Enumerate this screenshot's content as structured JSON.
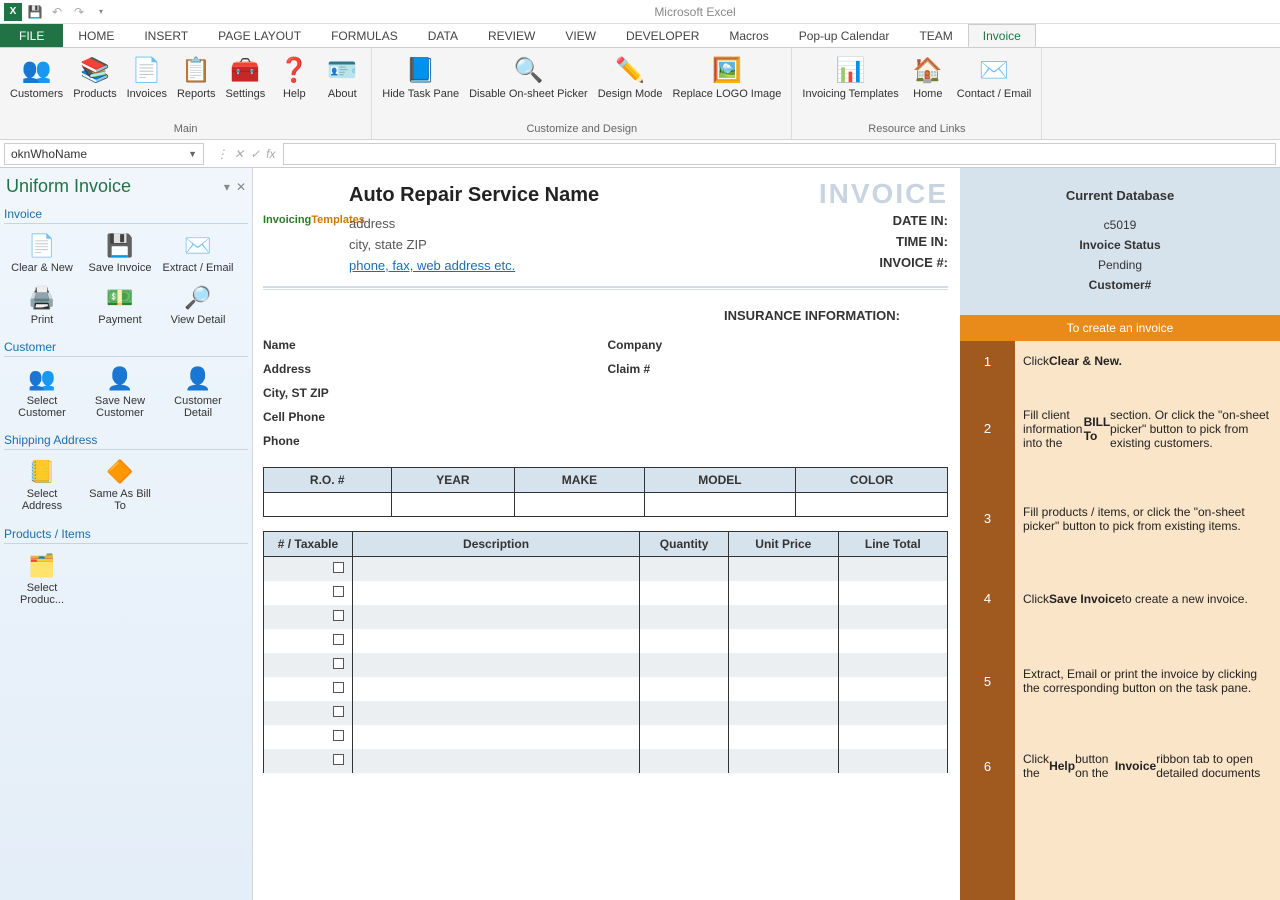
{
  "titlebar": {
    "app_title": "Microsoft Excel"
  },
  "ribbon": {
    "tabs": [
      "FILE",
      "HOME",
      "INSERT",
      "PAGE LAYOUT",
      "FORMULAS",
      "DATA",
      "REVIEW",
      "VIEW",
      "DEVELOPER",
      "Macros",
      "Pop-up Calendar",
      "TEAM",
      "Invoice"
    ],
    "active_tab": "Invoice",
    "groups": [
      {
        "label": "Main",
        "items": [
          {
            "label": "Customers",
            "icon": "👥"
          },
          {
            "label": "Products",
            "icon": "📚"
          },
          {
            "label": "Invoices",
            "icon": "📄"
          },
          {
            "label": "Reports",
            "icon": "📋"
          },
          {
            "label": "Settings",
            "icon": "🧰"
          },
          {
            "label": "Help",
            "icon": "❓"
          },
          {
            "label": "About",
            "icon": "🪪"
          }
        ]
      },
      {
        "label": "Customize and Design",
        "items": [
          {
            "label": "Hide Task Pane",
            "icon": "📘"
          },
          {
            "label": "Disable On-sheet Picker",
            "icon": "🔍"
          },
          {
            "label": "Design Mode",
            "icon": "✏️"
          },
          {
            "label": "Replace LOGO Image",
            "icon": "🖼️"
          }
        ]
      },
      {
        "label": "Resource and Links",
        "items": [
          {
            "label": "Invoicing Templates",
            "icon": "📊"
          },
          {
            "label": "Home",
            "icon": "🏠"
          },
          {
            "label": "Contact / Email",
            "icon": "✉️"
          }
        ]
      }
    ]
  },
  "formula_bar": {
    "name_box": "oknWhoName",
    "fx_label": "fx"
  },
  "taskpane": {
    "title": "Uniform Invoice",
    "sections": [
      {
        "title": "Invoice",
        "items": [
          {
            "label": "Clear & New",
            "icon": "📄"
          },
          {
            "label": "Save Invoice",
            "icon": "💾"
          },
          {
            "label": "Extract / Email",
            "icon": "✉️"
          },
          {
            "label": "Print",
            "icon": "🖨️"
          },
          {
            "label": "Payment",
            "icon": "💵"
          },
          {
            "label": "View Detail",
            "icon": "🔎"
          }
        ]
      },
      {
        "title": "Customer",
        "items": [
          {
            "label": "Select Customer",
            "icon": "👥"
          },
          {
            "label": "Save New Customer",
            "icon": "👤"
          },
          {
            "label": "Customer Detail",
            "icon": "👤"
          }
        ]
      },
      {
        "title": "Shipping Address",
        "items": [
          {
            "label": "Select Address",
            "icon": "📒"
          },
          {
            "label": "Same As Bill To",
            "icon": "🔶"
          }
        ]
      },
      {
        "title": "Products / Items",
        "items": [
          {
            "label": "Select Produc...",
            "icon": "🗂️"
          }
        ]
      }
    ]
  },
  "invoice": {
    "company_name": "Auto Repair Service Name",
    "logo_left": "Invoicing",
    "logo_right": "Templates",
    "address": "address",
    "city_state": "city, state ZIP",
    "contact": "phone, fax, web address etc.",
    "big_title": "INVOICE",
    "header_right": [
      "DATE IN:",
      "TIME IN:",
      "INVOICE #:"
    ],
    "insurance_title": "INSURANCE INFORMATION:",
    "billto_left": [
      "Name",
      "Address",
      "City, ST ZIP",
      "Cell Phone",
      "Phone"
    ],
    "billto_right": [
      "Company",
      "Claim #"
    ],
    "vehicle_cols": [
      "R.O. #",
      "YEAR",
      "MAKE",
      "MODEL",
      "COLOR"
    ],
    "item_cols": [
      "# / Taxable",
      "Description",
      "Quantity",
      "Unit Price",
      "Line Total"
    ],
    "item_rows": 9
  },
  "rightpanel": {
    "header_title": "Current Database",
    "db_code": "c5019",
    "status_label": "Invoice Status",
    "status_value": "Pending",
    "customer_label": "Customer#",
    "orange_bar": "To create an invoice",
    "steps": [
      {
        "n": "1",
        "h": 40,
        "html": "Click <b>Clear & New.</b>"
      },
      {
        "n": "2",
        "h": 95,
        "html": "Fill client information into the <b>BILL To</b> section. Or click the \"on-sheet picker\" button to pick from existing customers."
      },
      {
        "n": "3",
        "h": 85,
        "html": "Fill products / items, or click the \"on-sheet picker\" button to pick from existing items."
      },
      {
        "n": "4",
        "h": 75,
        "html": "Click <b>Save Invoice</b> to create a new invoice."
      },
      {
        "n": "5",
        "h": 90,
        "html": "Extract, Email or print the invoice by clicking the corresponding button on the task pane."
      },
      {
        "n": "6",
        "h": 80,
        "html": "Click the <b>Help</b> button on the <b>Invoice</b> ribbon tab to open detailed documents"
      }
    ]
  }
}
